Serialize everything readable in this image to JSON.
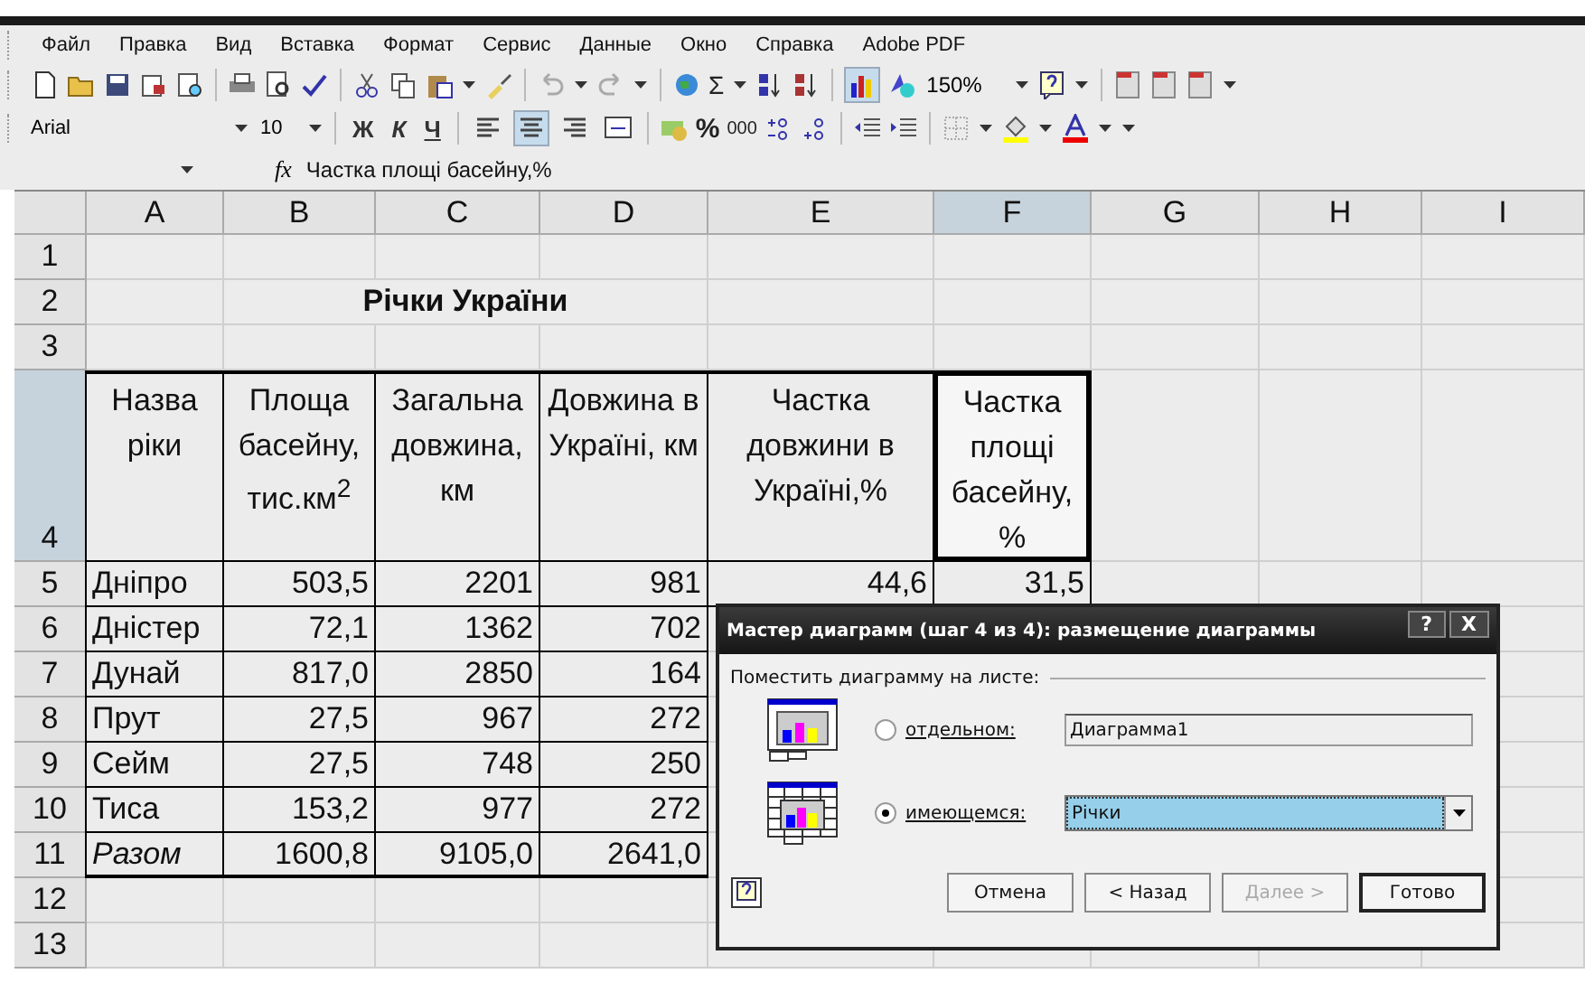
{
  "menu": [
    {
      "label": "Файл"
    },
    {
      "label": "Правка"
    },
    {
      "label": "Вид"
    },
    {
      "label": "Вставка"
    },
    {
      "label": "Формат"
    },
    {
      "label": "Сервис"
    },
    {
      "label": "Данные"
    },
    {
      "label": "Окно"
    },
    {
      "label": "Справка"
    },
    {
      "label": "Adobe PDF"
    }
  ],
  "toolbar": {
    "sum": "Σ",
    "zoom": "150%",
    "chart_pressed": true
  },
  "format_bar": {
    "font": "Arial",
    "size": "10",
    "styles": [
      "Ж",
      "К",
      "Ч"
    ],
    "align": [
      {
        "selected": false
      },
      {
        "selected": true
      },
      {
        "selected": false
      },
      {
        "selected": false
      }
    ],
    "percent": "%",
    "thousands": "000"
  },
  "formula_bar": {
    "fx": "fx",
    "content": "Частка площі басейну,%"
  },
  "sheet": {
    "columns": [
      {
        "label": "A",
        "selected": false
      },
      {
        "label": "B",
        "selected": false
      },
      {
        "label": "C",
        "selected": false
      },
      {
        "label": "D",
        "selected": false
      },
      {
        "label": "E",
        "selected": false
      },
      {
        "label": "F",
        "selected": true
      },
      {
        "label": "G",
        "selected": false
      },
      {
        "label": "H",
        "selected": false
      },
      {
        "label": "I",
        "selected": false
      }
    ],
    "rows": [
      {
        "label": "1",
        "selected": false,
        "kind": "blank"
      },
      {
        "label": "2",
        "selected": false,
        "kind": "title",
        "title": "Річки України"
      },
      {
        "label": "3",
        "selected": false,
        "kind": "blank"
      },
      {
        "label": "4",
        "selected": true,
        "kind": "header",
        "cells": [
          {
            "text": "Назва ріки",
            "active": false
          },
          {
            "text": "Площа басейну, тис.км$^{2}$",
            "active": false
          },
          {
            "text": "Загальна довжина, км",
            "active": false
          },
          {
            "text": "Довжина в Україні, км",
            "active": false
          },
          {
            "text": "Частка довжини в Україні,%",
            "active": false
          },
          {
            "text": "Частка площі басейну, %",
            "active": true
          }
        ]
      },
      {
        "label": "5",
        "selected": false,
        "kind": "data",
        "cells": [
          "Дніпро",
          "503,5",
          "2201",
          "981",
          "44,6",
          "31,5"
        ]
      },
      {
        "label": "6",
        "selected": false,
        "kind": "data",
        "cells": [
          "Дністер",
          "72,1",
          "1362",
          "702"
        ]
      },
      {
        "label": "7",
        "selected": false,
        "kind": "data",
        "cells": [
          "Дунай",
          "817,0",
          "2850",
          "164"
        ]
      },
      {
        "label": "8",
        "selected": false,
        "kind": "data",
        "cells": [
          "Прут",
          "27,5",
          "967",
          "272"
        ]
      },
      {
        "label": "9",
        "selected": false,
        "kind": "data",
        "cells": [
          "Сейм",
          "27,5",
          "748",
          "250"
        ]
      },
      {
        "label": "10",
        "selected": false,
        "kind": "data",
        "cells": [
          "Тиса",
          "153,2",
          "977",
          "272"
        ]
      },
      {
        "label": "11",
        "selected": false,
        "kind": "total",
        "cells": [
          "Разом",
          "1600,8",
          "9105,0",
          "2641,0"
        ]
      },
      {
        "label": "12",
        "selected": false,
        "kind": "blank"
      },
      {
        "label": "13",
        "selected": false,
        "kind": "blank"
      }
    ]
  },
  "dialog": {
    "title": "Мастер диаграмм (шаг 4 из 4): размещение диаграммы",
    "help": "?",
    "close": "X",
    "group_label": "Поместить диаграмму на листе:",
    "options": [
      {
        "kind": "sheet",
        "label": "отдельном:",
        "selected": false,
        "value": "Диаграмма1"
      },
      {
        "kind": "object",
        "label": "имеющемся:",
        "selected": true,
        "value": "Річки"
      }
    ],
    "buttons": [
      {
        "label": "Отмена",
        "disabled": false
      },
      {
        "label": "< Назад",
        "disabled": false
      },
      {
        "label": "Далее >",
        "disabled": true
      },
      {
        "label": "Готово",
        "disabled": false
      }
    ]
  }
}
